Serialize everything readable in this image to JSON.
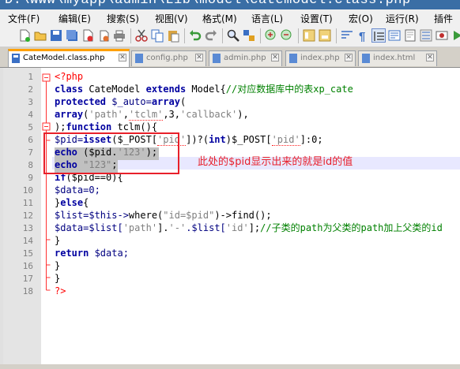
{
  "window": {
    "title": "D:\\www\\myapp\\admin\\Lib\\model\\catemodel.class.php"
  },
  "menu": [
    "文件(F)",
    "编辑(E)",
    "搜索(S)",
    "视图(V)",
    "格式(M)",
    "语言(L)",
    "设置(T)",
    "宏(O)",
    "运行(R)",
    "插件"
  ],
  "tabs": [
    {
      "label": "CateModel.class.php",
      "active": true
    },
    {
      "label": "config.php",
      "active": false
    },
    {
      "label": "admin.php",
      "active": false
    },
    {
      "label": "index.php",
      "active": false
    },
    {
      "label": "index.html",
      "active": false
    }
  ],
  "line_numbers": [
    "1",
    "2",
    "3",
    "4",
    "5",
    "6",
    "7",
    "8",
    "9",
    "10",
    "11",
    "12",
    "13",
    "14",
    "15",
    "16",
    "17",
    "18"
  ],
  "code": {
    "l1": "<?php",
    "l2a": "class",
    "l2b": " CateModel ",
    "l2c": "extends",
    "l2d": " Model{",
    "l2e": "//对应数据库中的表xp_cate",
    "l3a": "protected",
    "l3b": " $_auto=",
    "l3c": "array",
    "l3d": "(",
    "l4a": "array",
    "l4b": "(",
    "l4c": "'path'",
    "l4d": ",",
    "l4e": "'tclm'",
    "l4f": ",3,",
    "l4g": "'callback'",
    "l4h": "),",
    "l5a": ");",
    "l5b": "function",
    "l5c": " tclm(){",
    "l6a": "$pid=",
    "l6b": "isset",
    "l6c": "($_POST[",
    "l6d": "'pid'",
    "l6e": "])?(",
    "l6f": "int",
    "l6g": ")$_POST[",
    "l6h": "'pid'",
    "l6i": "]:0;",
    "l7a": "echo",
    "l7b": " ($pid.",
    "l7c": "'123'",
    "l7d": ");",
    "l8a": "echo",
    "l8b": " ",
    "l8c": "\"123\"",
    "l8d": ";",
    "l9a": "if",
    "l9b": "($pid==0){",
    "l10": "$data=0;",
    "l11a": "}",
    "l11b": "else",
    "l11c": "{",
    "l12a": "$list=$this->",
    "l12b": "where",
    "l12c": "(",
    "l12d": "\"id=$pid\"",
    "l12e": ")->",
    "l12f": "find",
    "l12g": "();",
    "l13a": "$data=$list[",
    "l13b": "'path'",
    "l13c": "].",
    "l13d": "'-'",
    "l13e": ".$list[",
    "l13f": "'id'",
    "l13g": "];",
    "l13h": "//子类的path为父类的path加上父类的id",
    "l14": "}",
    "l15a": "return",
    "l15b": " $data;",
    "l16": "}",
    "l17": "}",
    "l18": "?>"
  },
  "annotation": "此处的$pid显示出来的就是id的值",
  "colors": {
    "keyword": "#0000a0",
    "string": "#808080",
    "comment": "#008000",
    "annotation": "#e8202a",
    "active_tab": "#ffa000"
  }
}
